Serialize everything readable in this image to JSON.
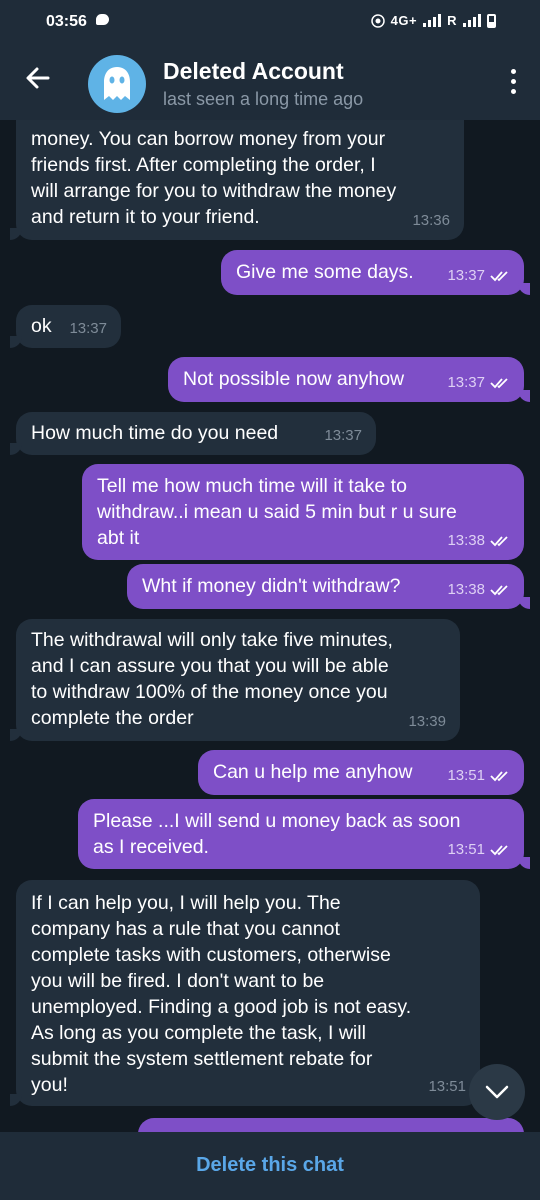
{
  "status_bar": {
    "time": "03:56",
    "network": "4G+",
    "roaming": "R"
  },
  "header": {
    "title": "Deleted Account",
    "subtitle": "last seen a long time ago"
  },
  "messages": [
    {
      "dir": "in",
      "text": "money. You can borrow money from your\nfriends first. After completing the order, I\nwill arrange for you to withdraw the money\nand return it to your friend.",
      "time": "13:36"
    },
    {
      "dir": "out",
      "text": "Give me some days.",
      "time": "13:37"
    },
    {
      "dir": "in",
      "text": "ok",
      "time": "13:37"
    },
    {
      "dir": "out",
      "text": "Not possible now anyhow",
      "time": "13:37"
    },
    {
      "dir": "in",
      "text": "How much time do you need",
      "time": "13:37"
    },
    {
      "dir": "out",
      "text": "Tell me how much time will it take to\nwithdraw..i mean u said 5 min but r u sure\nabt it",
      "time": "13:38"
    },
    {
      "dir": "out",
      "text": "Wht if money didn't withdraw?",
      "time": "13:38"
    },
    {
      "dir": "in",
      "text": "The withdrawal will only take five minutes,\nand I can assure you that you will be able\nto withdraw 100% of the money once you\ncomplete the order",
      "time": "13:39"
    },
    {
      "dir": "out",
      "text": "Can u help me anyhow",
      "time": "13:51"
    },
    {
      "dir": "out",
      "text": "Please ...I will send u money back as soon\nas I received.",
      "time": "13:51"
    },
    {
      "dir": "in",
      "text": "If I can help you, I will help you. The\ncompany has a rule that you cannot\ncomplete tasks with customers, otherwise\nyou will be fired. I don't want to be\nunemployed. Finding a good job is not easy.\nAs long as you complete the task, I will\nsubmit the system settlement rebate for\nyou!",
      "time": "13:51"
    }
  ],
  "bottom_bar": {
    "action": "Delete this chat"
  },
  "colors": {
    "incoming_bubble": "#222f3c",
    "outgoing_bubble": "#7e4fc7",
    "accent": "#5aa7e8",
    "avatar": "#5fb3e6"
  }
}
